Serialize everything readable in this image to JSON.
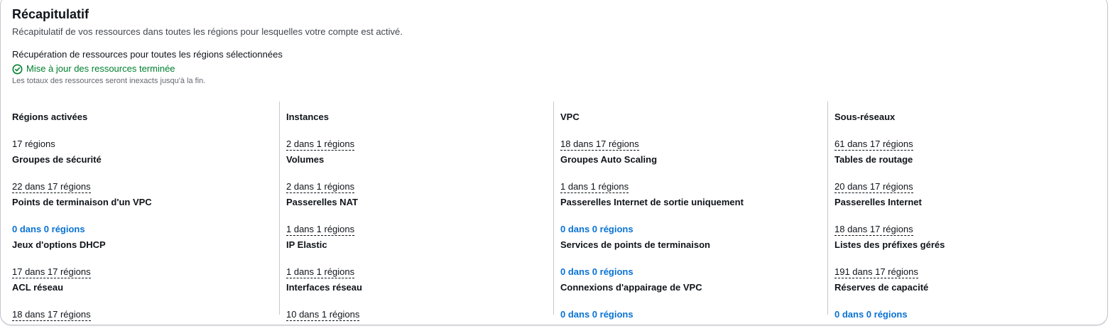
{
  "header": {
    "title": "Récapitulatif",
    "description": "Récapitulatif de vos ressources dans toutes les régions pour lesquelles votre compte est activé."
  },
  "status": {
    "fetch_label": "Récupération de ressources pour toutes les régions sélectionnées",
    "status_text": "Mise à jour des ressources terminée",
    "note": "Les totaux des ressources seront inexacts jusqu'à la fin.",
    "success_color": "#00802f",
    "icon": "check-circle-icon"
  },
  "columns": [
    [
      {
        "label": "Régions activées",
        "value": "17 régions",
        "style": "plain"
      },
      {
        "label": "Groupes de sécurité",
        "value": "22 dans 17 régions",
        "style": "dotted"
      },
      {
        "label": "Points de terminaison d'un VPC",
        "value": "0 dans 0 régions",
        "style": "link"
      },
      {
        "label": "Jeux d'options DHCP",
        "value": "17 dans 17 régions",
        "style": "dotted"
      },
      {
        "label": "ACL réseau",
        "value": "18 dans 17 régions",
        "style": "dotted"
      }
    ],
    [
      {
        "label": "Instances",
        "value": "2 dans 1 régions",
        "style": "dotted"
      },
      {
        "label": "Volumes",
        "value": "2 dans 1 régions",
        "style": "dotted"
      },
      {
        "label": "Passerelles NAT",
        "value": "1 dans 1 régions",
        "style": "dotted"
      },
      {
        "label": "IP Elastic",
        "value": "1 dans 1 régions",
        "style": "dotted"
      },
      {
        "label": "Interfaces réseau",
        "value": "10 dans 1 régions",
        "style": "dotted"
      }
    ],
    [
      {
        "label": "VPC",
        "value": "18 dans 17 régions",
        "style": "dotted"
      },
      {
        "label": "Groupes Auto Scaling",
        "value": "1 dans 1 régions",
        "style": "dotted"
      },
      {
        "label": "Passerelles Internet de sortie uniquement",
        "value": "0 dans 0 régions",
        "style": "link"
      },
      {
        "label": "Services de points de terminaison",
        "value": "0 dans 0 régions",
        "style": "link"
      },
      {
        "label": "Connexions d'appairage de VPC",
        "value": "0 dans 0 régions",
        "style": "link"
      }
    ],
    [
      {
        "label": "Sous-réseaux",
        "value": "61 dans 17 régions",
        "style": "dotted"
      },
      {
        "label": "Tables de routage",
        "value": "20 dans 17 régions",
        "style": "dotted"
      },
      {
        "label": "Passerelles Internet",
        "value": "18 dans 17 régions",
        "style": "dotted"
      },
      {
        "label": "Listes des préfixes gérés",
        "value": "191 dans 17 régions",
        "style": "dotted"
      },
      {
        "label": "Réserves de capacité",
        "value": "0 dans 0 régions",
        "style": "link"
      }
    ]
  ],
  "colors": {
    "link": "#0972d3",
    "text": "#0f141a",
    "muted": "#424650",
    "divider": "#c6c6cd"
  }
}
